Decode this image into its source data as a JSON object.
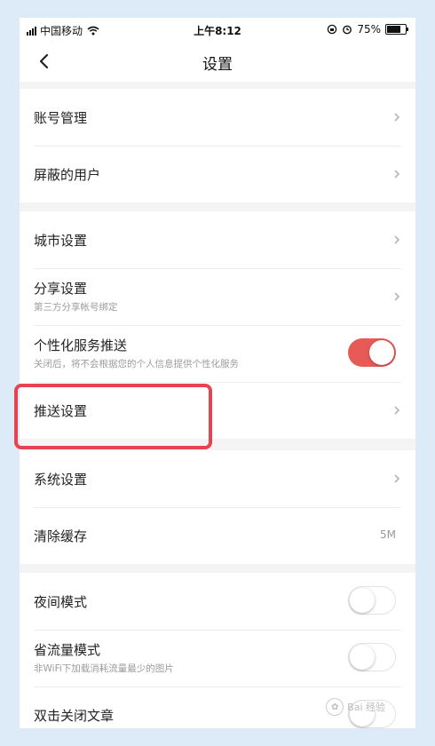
{
  "status_bar": {
    "carrier": "中国移动",
    "time": "上午8:12",
    "battery": "75%"
  },
  "nav": {
    "title": "设置"
  },
  "groups": [
    {
      "items": [
        {
          "label": "账号管理",
          "control": "chevron"
        },
        {
          "label": "屏蔽的用户",
          "control": "chevron"
        }
      ]
    },
    {
      "items": [
        {
          "label": "城市设置",
          "control": "chevron"
        },
        {
          "label": "分享设置",
          "sub": "第三方分享帐号绑定",
          "control": "chevron"
        },
        {
          "label": "个性化服务推送",
          "sub": "关闭后，将不会根据您的个人信息提供个性化服务",
          "control": "toggle",
          "state": "on"
        },
        {
          "label": "推送设置",
          "control": "chevron"
        }
      ]
    },
    {
      "items": [
        {
          "label": "系统设置",
          "control": "chevron"
        },
        {
          "label": "清除缓存",
          "control": "value",
          "value": "5M"
        }
      ]
    },
    {
      "items": [
        {
          "label": "夜间模式",
          "control": "toggle",
          "state": "off"
        },
        {
          "label": "省流量模式",
          "sub": "非WiFi下加载消耗流量最少的图片",
          "control": "toggle",
          "state": "off"
        },
        {
          "label": "双击关闭文章",
          "control": "toggle",
          "state": "off"
        }
      ]
    }
  ],
  "watermark": "Bai 经验",
  "colors": {
    "accent": "#e85a56",
    "highlight": "#e64550"
  }
}
